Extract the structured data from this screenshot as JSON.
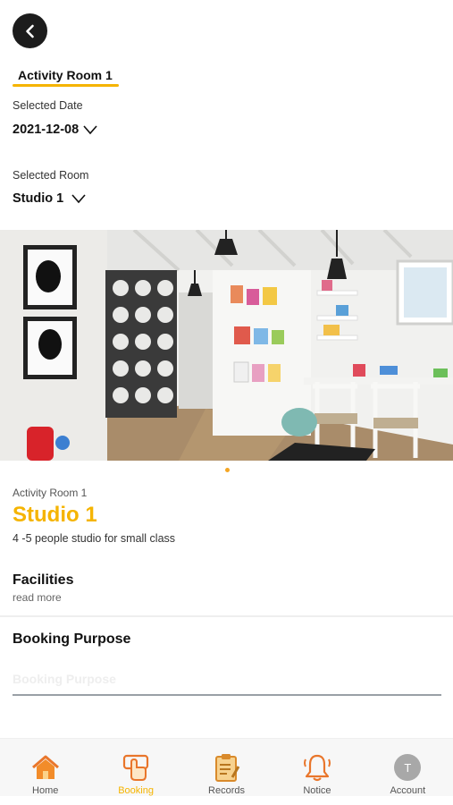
{
  "header": {
    "back_icon": "chevron-left-icon",
    "tab_title": "Activity Room 1",
    "accent_color": "#f5b400"
  },
  "form": {
    "date_label": "Selected Date",
    "date_value": "2021-12-08",
    "room_label": "Selected Room",
    "room_value": "Studio 1"
  },
  "gallery": {
    "image": "playroom-studio-photo",
    "slide_count": 1,
    "active_slide": 1
  },
  "room": {
    "category": "Activity Room 1",
    "name": "Studio 1",
    "description": "4 -5 people studio for small class"
  },
  "facilities": {
    "title": "Facilities",
    "link": "read more"
  },
  "booking_purpose": {
    "title": "Booking Purpose",
    "placeholder": "Booking Purpose",
    "value": ""
  },
  "nav": {
    "items": [
      {
        "label": "Home",
        "icon": "home-icon",
        "active": false
      },
      {
        "label": "Booking",
        "icon": "booking-hand-icon",
        "active": true
      },
      {
        "label": "Records",
        "icon": "clipboard-icon",
        "active": false
      },
      {
        "label": "Notice",
        "icon": "bell-icon",
        "active": false
      },
      {
        "label": "Account",
        "icon": "avatar",
        "avatar_letter": "T",
        "active": false
      }
    ]
  }
}
